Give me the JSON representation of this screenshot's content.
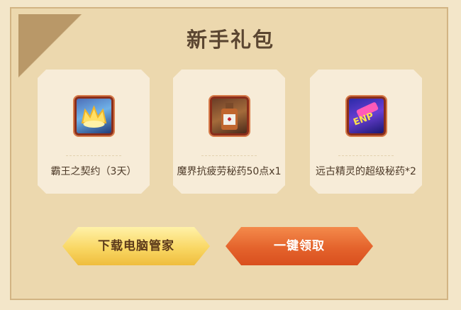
{
  "dialog": {
    "title": "新手礼包"
  },
  "items": [
    {
      "label": "霸王之契约（3天）",
      "icon": "crown-icon"
    },
    {
      "label": "魔界抗疲劳秘药50点x1",
      "icon": "potion-bottle-icon"
    },
    {
      "label": "远古精灵的超级秘药*2",
      "icon": "elixir-icon",
      "icon_text": "ENP"
    }
  ],
  "buttons": {
    "download_label": "下载电脑管家",
    "claim_label": "一键领取"
  },
  "colors": {
    "panel_bg": "#ecd8ae",
    "card_bg": "#f7ecd8",
    "download_button": "#f9d764",
    "claim_button": "#e4632c"
  }
}
